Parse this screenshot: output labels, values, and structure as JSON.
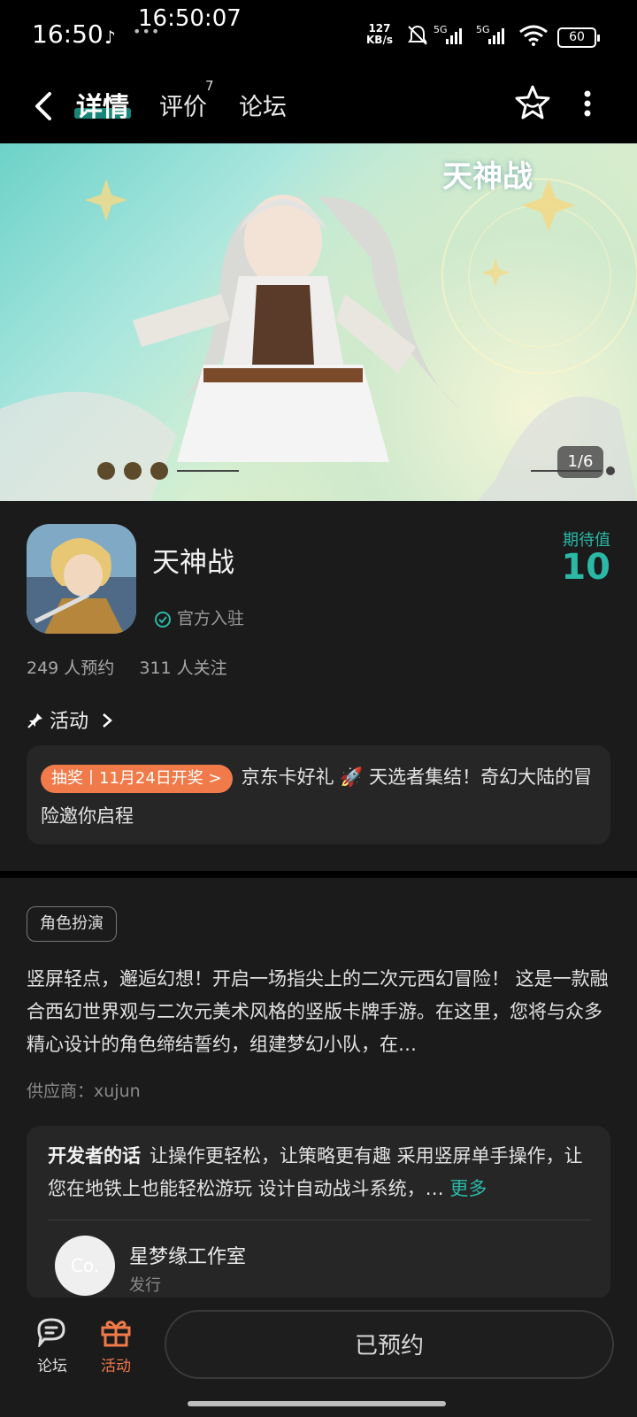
{
  "status_bar": {
    "time": "16:50",
    "overlay_time": "16:50:07",
    "net_speed_value": "127",
    "net_speed_unit": "KB/s",
    "sig1": "5G",
    "sig2": "5G",
    "battery": "60"
  },
  "nav": {
    "tabs": [
      {
        "label": "详情"
      },
      {
        "label": "评价"
      },
      {
        "label": "论坛"
      }
    ],
    "review_count": "7"
  },
  "banner": {
    "logo_text": "天神战",
    "counter": "1/6"
  },
  "app": {
    "name": "天神战",
    "official": "官方入驻",
    "expect_label": "期待值",
    "expect_value": "10",
    "reservations": "249 人预约",
    "followers": "311 人关注"
  },
  "activity": {
    "heading": "活动",
    "pill": "抽奖丨11月24日开奖 >",
    "text": "京东卡好礼 🚀 天选者集结！奇幻大陆的冒险邀你启程"
  },
  "details": {
    "genre": "角色扮演",
    "description": "竖屏轻点，邂逅幻想！开启一场指尖上的二次元西幻冒险！ 这是一款融合西幻世界观与二次元美术风格的竖版卡牌手游。在这里，您将与众多精心设计的角色缔结誓约，组建梦幻小队，在…",
    "supplier": "供应商：xujun"
  },
  "developer": {
    "title": "开发者的话",
    "text": "让操作更轻松，让策略更有趣 采用竖屏单手操作，让您在地铁上也能轻松游玩 设计自动战斗系统，…",
    "more": "更多",
    "avatar_text": "Co.",
    "studio": "星梦缘工作室",
    "role": "发行"
  },
  "bottom": {
    "forum_label": "论坛",
    "activity_label": "活动",
    "reserve_label": "已预约"
  },
  "colors": {
    "accent": "#2bb8a7",
    "pill": "#f07a4a",
    "activity_active": "#f07a4a"
  }
}
